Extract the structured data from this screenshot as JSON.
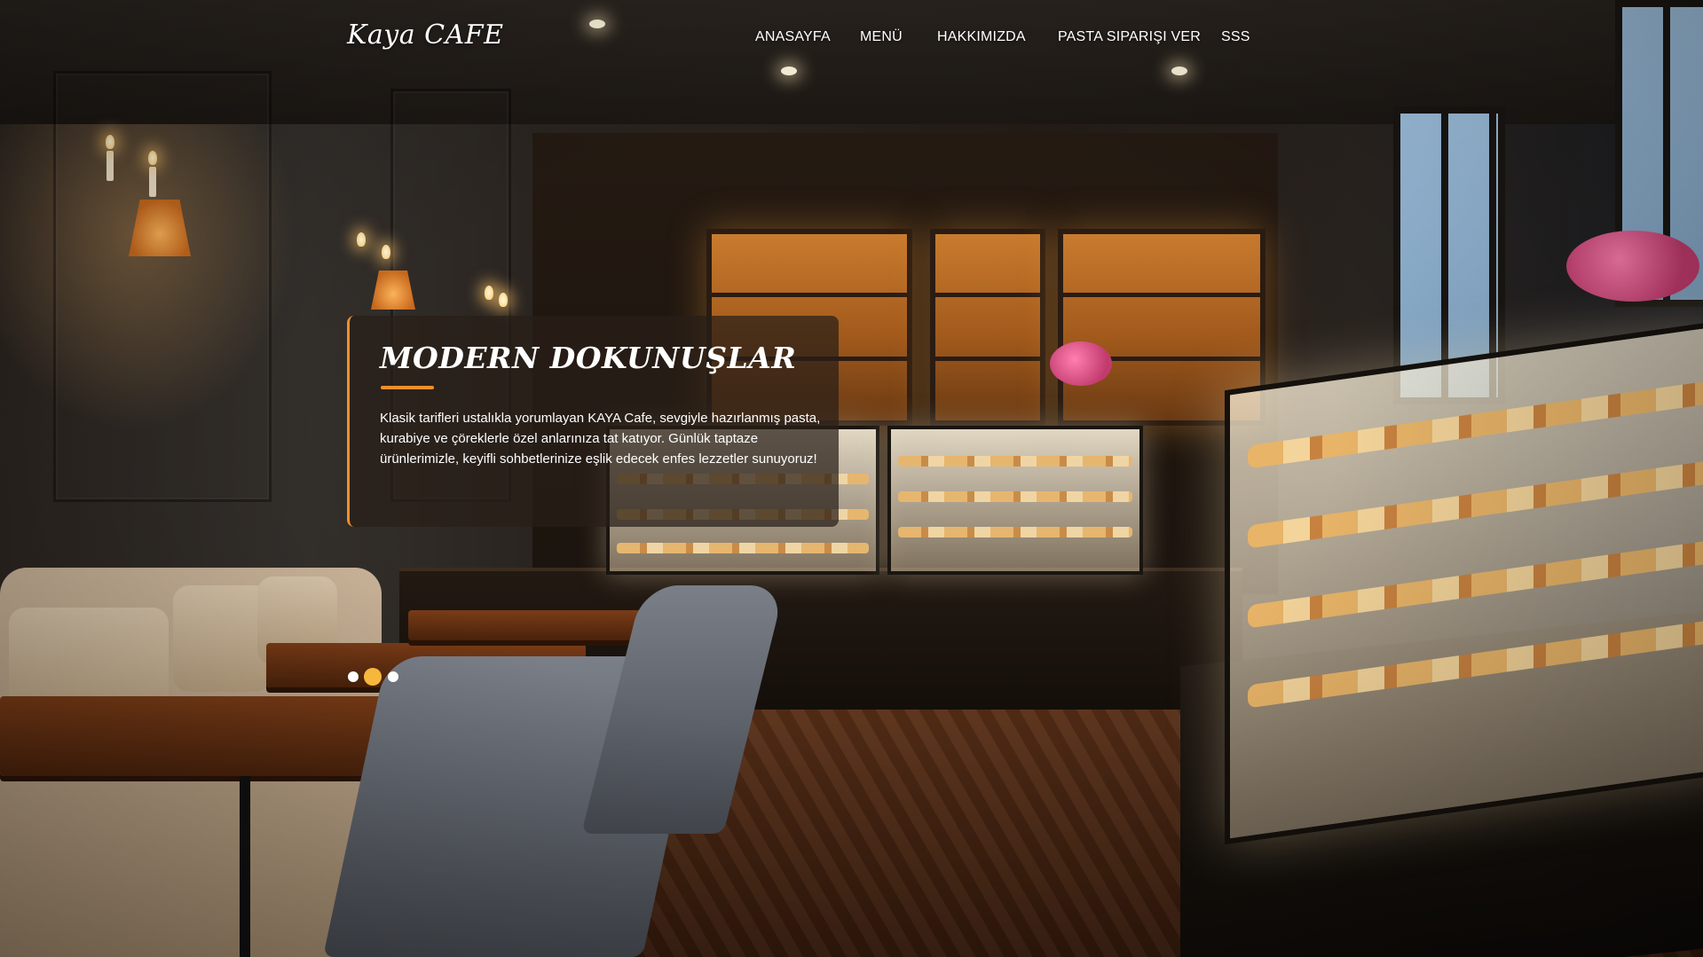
{
  "brand": {
    "logo_text": "Kaya CAFE"
  },
  "nav": {
    "items": [
      {
        "label": "ANASAYFA"
      },
      {
        "label": "MENÜ"
      },
      {
        "label": "HAKKIMIZDA"
      },
      {
        "label": "PASTA SIPARIŞI VER"
      },
      {
        "label": "SSS"
      }
    ]
  },
  "hero": {
    "title": "MODERN DOKUNUŞLAR",
    "text": "Klasik tarifleri ustalıkla yorumlayan KAYA Cafe, sevgiyle hazırlanmış pasta, kurabiye ve çöreklerle özel anlarınıza tat katıyor. Günlük taptaze ürünlerimizle, keyifli sohbetlerinize eşlik edecek enfes lezzetler sunuyoruz!"
  },
  "slider": {
    "count": 3,
    "active_index": 1
  },
  "colors": {
    "accent": "#f0902a",
    "active_dot": "#f6b73c",
    "text": "#ffffff"
  }
}
